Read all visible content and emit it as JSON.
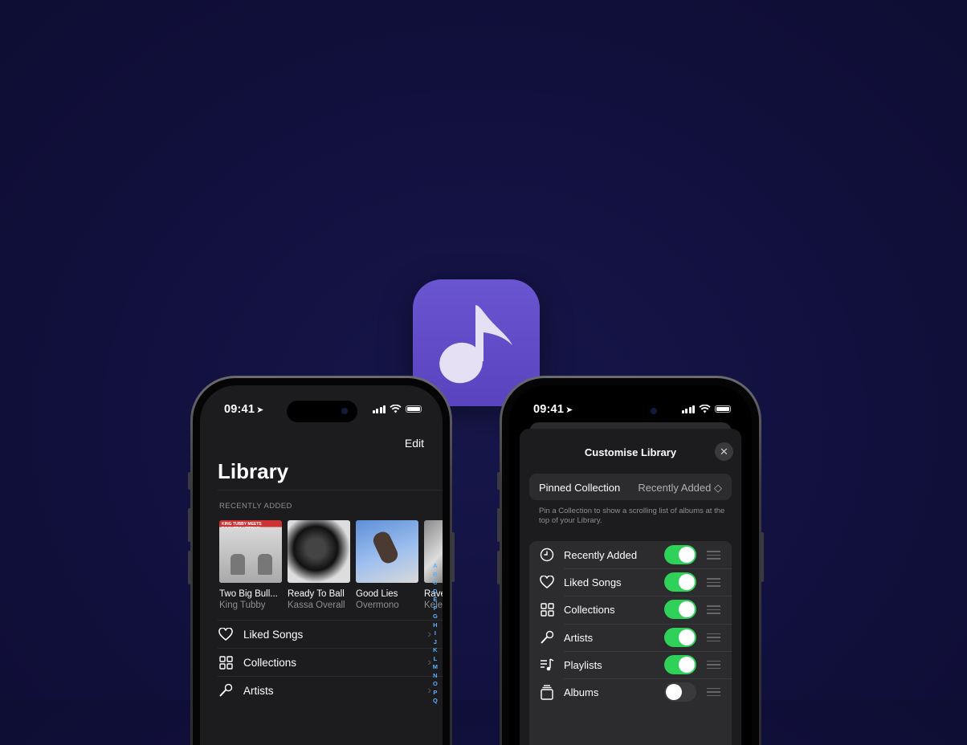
{
  "status_bar": {
    "time": "09:41"
  },
  "library": {
    "edit_label": "Edit",
    "title": "Library",
    "recently_added_label": "RECENTLY ADDED",
    "albums": [
      {
        "title": "Two Big Bull...",
        "artist": "King Tubby",
        "banner": "KING TUBBY MEETS ROCKERS UPTOWN"
      },
      {
        "title": "Ready To Ball",
        "artist": "Kassa Overall"
      },
      {
        "title": "Good Lies",
        "artist": "Overmono"
      },
      {
        "title": "Raven",
        "artist": "Kelela"
      }
    ],
    "items": [
      {
        "label": "Liked Songs",
        "icon": "heart-icon"
      },
      {
        "label": "Collections",
        "icon": "grid-icon"
      },
      {
        "label": "Artists",
        "icon": "microphone-icon"
      }
    ],
    "index_letters": [
      "A",
      "B",
      "C",
      "D",
      "E",
      "F",
      "G",
      "H",
      "I",
      "J",
      "K",
      "L",
      "M",
      "N",
      "O",
      "P",
      "Q"
    ]
  },
  "customise": {
    "title": "Customise Library",
    "close_icon": "close-icon",
    "pinned_label": "Pinned Collection",
    "pinned_value": "Recently Added ◇",
    "pinned_description": "Pin a Collection to show a scrolling list of albums at the top of your Library.",
    "toggles": [
      {
        "label": "Recently Added",
        "on": true,
        "icon": "clock-icon"
      },
      {
        "label": "Liked Songs",
        "on": true,
        "icon": "heart-icon"
      },
      {
        "label": "Collections",
        "on": true,
        "icon": "grid-icon"
      },
      {
        "label": "Artists",
        "on": true,
        "icon": "microphone-icon"
      },
      {
        "label": "Playlists",
        "on": true,
        "icon": "playlist-icon"
      },
      {
        "label": "Albums",
        "on": false,
        "icon": "album-stack-icon"
      }
    ]
  },
  "colors": {
    "background": "#121140",
    "app_icon": "#5f48c6",
    "toggle_on": "#30d158",
    "index_blue": "#5ab0ff"
  }
}
